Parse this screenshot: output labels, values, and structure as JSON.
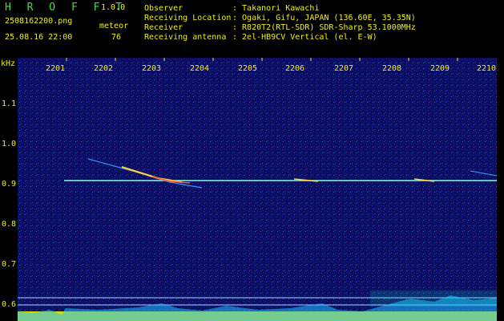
{
  "header": {
    "title": "H R O F F T",
    "version": "1.0.0",
    "filename": "2508162200.png",
    "datetime": "25.08.16 22:00",
    "type_label": "meteor",
    "count": "76",
    "fields": [
      {
        "label": "Observer",
        "value": ": Takanori Kawachi"
      },
      {
        "label": "Receiving Location",
        "value": ": Ogaki, Gifu, JAPAN (136.60E, 35.35N)"
      },
      {
        "label": "Receiver",
        "value": ": R820T2(RTL-SDR) SDR-Sharp 53.1000MHz"
      },
      {
        "label": "Receiving antenna",
        "value": ": 2el-HB9CV Vertical (el. E-W)"
      }
    ]
  },
  "axes": {
    "y_unit": "kHz",
    "y_ticks": [
      "1.1",
      "1.0",
      "0.9",
      "0.8",
      "0.7",
      "0.6"
    ],
    "x_ticks": [
      "2201",
      "2202",
      "2203",
      "2204",
      "2205",
      "2206",
      "2207",
      "2208",
      "2209",
      "2210"
    ]
  },
  "colors": {
    "text_yellow": "#f2f200",
    "title_green": "#3fe03f",
    "background": "#000000",
    "spectrum_bg": "#0a0a66"
  }
}
